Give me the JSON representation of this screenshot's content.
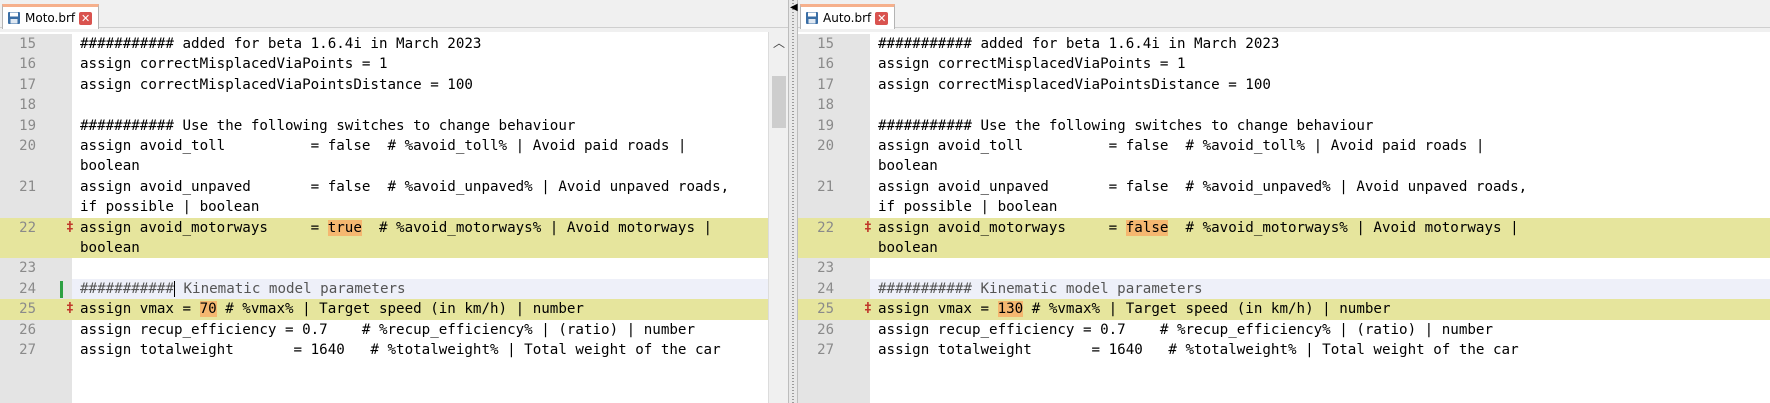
{
  "left": {
    "tab_label": "Moto.brf",
    "lines": [
      {
        "n": "15",
        "text": "########### added for beta 1.6.4i in March 2023"
      },
      {
        "n": "16",
        "text": "assign correctMisplacedViaPoints = 1"
      },
      {
        "n": "17",
        "text": "assign correctMisplacedViaPointsDistance = 100"
      },
      {
        "n": "18",
        "text": ""
      },
      {
        "n": "19",
        "text": "########### Use the following switches to change behaviour"
      },
      {
        "n": "20",
        "text": "assign avoid_toll          = false  # %avoid_toll% | Avoid paid roads |"
      },
      {
        "n": "",
        "text": "boolean"
      },
      {
        "n": "21",
        "text": "assign avoid_unpaved       = false  # %avoid_unpaved% | Avoid unpaved roads,"
      },
      {
        "n": "",
        "text": "if possible | boolean"
      },
      {
        "n": "22",
        "pre": "assign avoid_motorways     = ",
        "hl": "true",
        "post": "  # %avoid_motorways% | Avoid motorways |"
      },
      {
        "n": "",
        "text": "boolean"
      },
      {
        "n": "23",
        "text": ""
      },
      {
        "n": "24",
        "pre": "###########",
        "post": " Kinematic model parameters"
      },
      {
        "n": "25",
        "pre": "assign vmax = ",
        "hl": "70",
        "post": " # %vmax% | Target speed (in km/h) | number"
      },
      {
        "n": "26",
        "text": "assign recup_efficiency = 0.7    # %recup_efficiency% | (ratio) | number"
      },
      {
        "n": "27",
        "text": "assign totalweight       = 1640   # %totalweight% | Total weight of the car"
      }
    ]
  },
  "right": {
    "tab_label": "Auto.brf",
    "lines": [
      {
        "n": "15",
        "text": "########### added for beta 1.6.4i in March 2023"
      },
      {
        "n": "16",
        "text": "assign correctMisplacedViaPoints = 1"
      },
      {
        "n": "17",
        "text": "assign correctMisplacedViaPointsDistance = 100"
      },
      {
        "n": "18",
        "text": ""
      },
      {
        "n": "19",
        "text": "########### Use the following switches to change behaviour"
      },
      {
        "n": "20",
        "text": "assign avoid_toll          = false  # %avoid_toll% | Avoid paid roads |"
      },
      {
        "n": "",
        "text": "boolean"
      },
      {
        "n": "21",
        "text": "assign avoid_unpaved       = false  # %avoid_unpaved% | Avoid unpaved roads,"
      },
      {
        "n": "",
        "text": "if possible | boolean"
      },
      {
        "n": "22",
        "pre": "assign avoid_motorways     = ",
        "hl": "false",
        "post": "  # %avoid_motorways% | Avoid motorways |"
      },
      {
        "n": "",
        "text": "boolean"
      },
      {
        "n": "23",
        "text": ""
      },
      {
        "n": "24",
        "text": "########### Kinematic model parameters"
      },
      {
        "n": "25",
        "pre": "assign vmax = ",
        "hl": "130",
        "post": " # %vmax% | Target speed (in km/h) | number"
      },
      {
        "n": "26",
        "text": "assign recup_efficiency = 0.7    # %recup_efficiency% | (ratio) | number"
      },
      {
        "n": "27",
        "text": "assign totalweight       = 1640   # %totalweight% | Total weight of the car"
      }
    ]
  },
  "colors": {
    "changed_line": "#e6e59d",
    "diff_highlight": "#f5b770",
    "tab_accent": "#f6b08c",
    "diff_marker": "#c0392b",
    "modified_bar": "#2ea043"
  },
  "icons": {
    "tab_icon": "save-disk-icon",
    "close_icon": "close-icon",
    "diff_marker": "diff-change-icon",
    "scroll_up": "chevron-up-icon"
  }
}
